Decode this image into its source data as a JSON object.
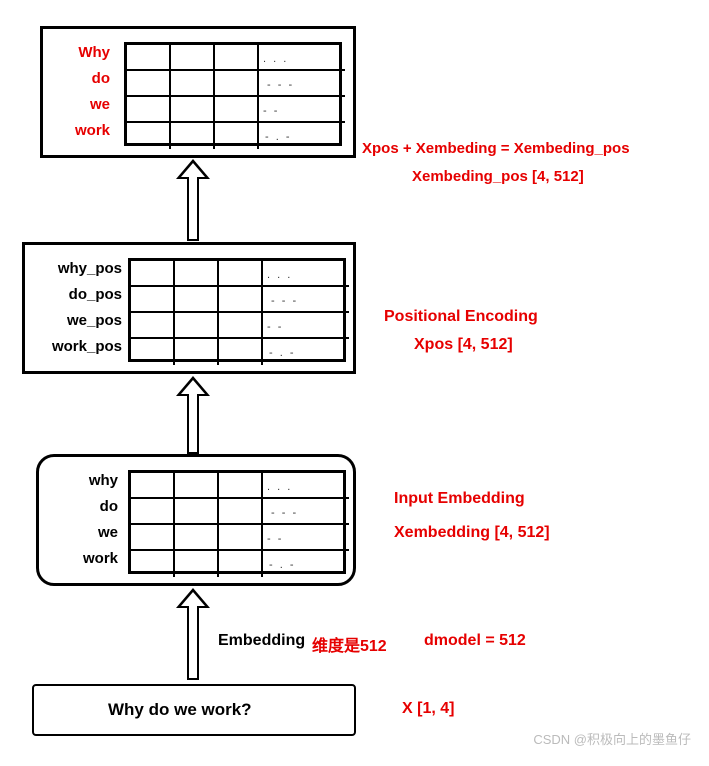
{
  "block_top": {
    "rows": [
      "Why",
      "do",
      "we",
      "work"
    ],
    "annot1": "Xpos + Xembeding = Xembeding_pos",
    "annot2": "Xembeding_pos [4, 512]"
  },
  "block_mid": {
    "rows": [
      "why_pos",
      "do_pos",
      "we_pos",
      "work_pos"
    ],
    "annot1": "Positional Encoding",
    "annot2": "Xpos [4, 512]"
  },
  "block_emb": {
    "rows": [
      "why",
      "do",
      "we",
      "work"
    ],
    "annot1": "Input Embedding",
    "annot2": "Xembedding [4, 512]"
  },
  "input_row": {
    "label_left": "Embedding",
    "label_dims": "维度是512",
    "label_dmodel": "dmodel = 512",
    "sentence": "Why do we work?",
    "x_shape": "X [1, 4]"
  },
  "watermark": "CSDN @积极向上的墨鱼仔"
}
